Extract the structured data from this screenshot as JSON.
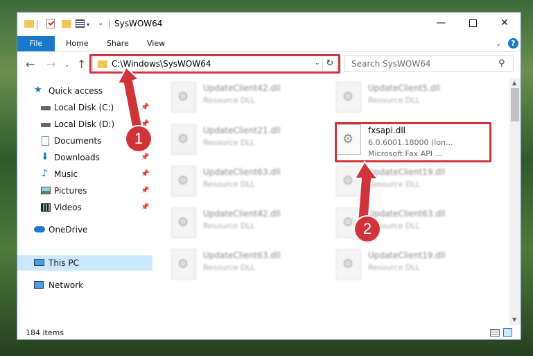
{
  "window": {
    "title": "SysWOW64",
    "minimize_glyph": "—",
    "close_glyph": "✕"
  },
  "quick_access_toolbar": {
    "more_glyph": "⌄",
    "arrow_glyph": "▾"
  },
  "ribbon": {
    "tabs": [
      "File",
      "Home",
      "Share",
      "View"
    ],
    "expand_glyph": "⌄",
    "help_glyph": "?"
  },
  "nav": {
    "back_glyph": "←",
    "forward_glyph": "→",
    "recent_glyph": "⌄",
    "up_glyph": "↑",
    "refresh_glyph": "↻"
  },
  "address": {
    "path": "C:\\Windows\\SysWOW64",
    "drop_glyph": "⌄"
  },
  "search": {
    "placeholder": "Search SysWOW64",
    "icon_glyph": "⚲"
  },
  "sidebar": {
    "items": [
      {
        "label": "Quick access",
        "icon": "star-icon"
      },
      {
        "label": "Local Disk (C:)",
        "icon": "drive-icon"
      },
      {
        "label": "Local Disk (D:)",
        "icon": "drive-icon"
      },
      {
        "label": "Documents",
        "icon": "documents-icon"
      },
      {
        "label": "Downloads",
        "icon": "download-icon"
      },
      {
        "label": "Music",
        "icon": "music-icon"
      },
      {
        "label": "Pictures",
        "icon": "pictures-icon"
      },
      {
        "label": "Videos",
        "icon": "videos-icon"
      },
      {
        "label": "OneDrive",
        "icon": "cloud-icon"
      },
      {
        "label": "This PC",
        "icon": "computer-icon"
      },
      {
        "label": "Network",
        "icon": "network-icon"
      }
    ],
    "pin_glyph": "📌"
  },
  "files": [
    {
      "name": "UpdateClient42.dll",
      "type": "Resource DLL"
    },
    {
      "name": "UpdateClient5.dll",
      "type": "Resource DLL"
    },
    {
      "name": "UpdateClient21.dll",
      "type": "Resource DLL"
    },
    {
      "name": "fxsapi.dll",
      "version": "6.0.6001.18000 (lon...",
      "company": "Microsoft  Fax API ..."
    },
    {
      "name": "UpdateClient63.dll",
      "type": "Resource DLL"
    },
    {
      "name": "UpdateClient19.dll",
      "type": "Resource DLL"
    },
    {
      "name": "UpdateClient42.dll",
      "type": "Resource DLL"
    },
    {
      "name": "UpdateClient63.dll",
      "type": "Resource DLL"
    },
    {
      "name": "UpdateClient63.dll",
      "type": "Resource DLL"
    },
    {
      "name": "UpdateClient19.dll",
      "type": "Resource DLL"
    }
  ],
  "status": {
    "items_count": "184 items"
  },
  "annotations": {
    "badge1": "1",
    "badge2": "2",
    "color": "#d0343a"
  },
  "scrollbar": {
    "up_glyph": "▲",
    "down_glyph": "▼"
  }
}
